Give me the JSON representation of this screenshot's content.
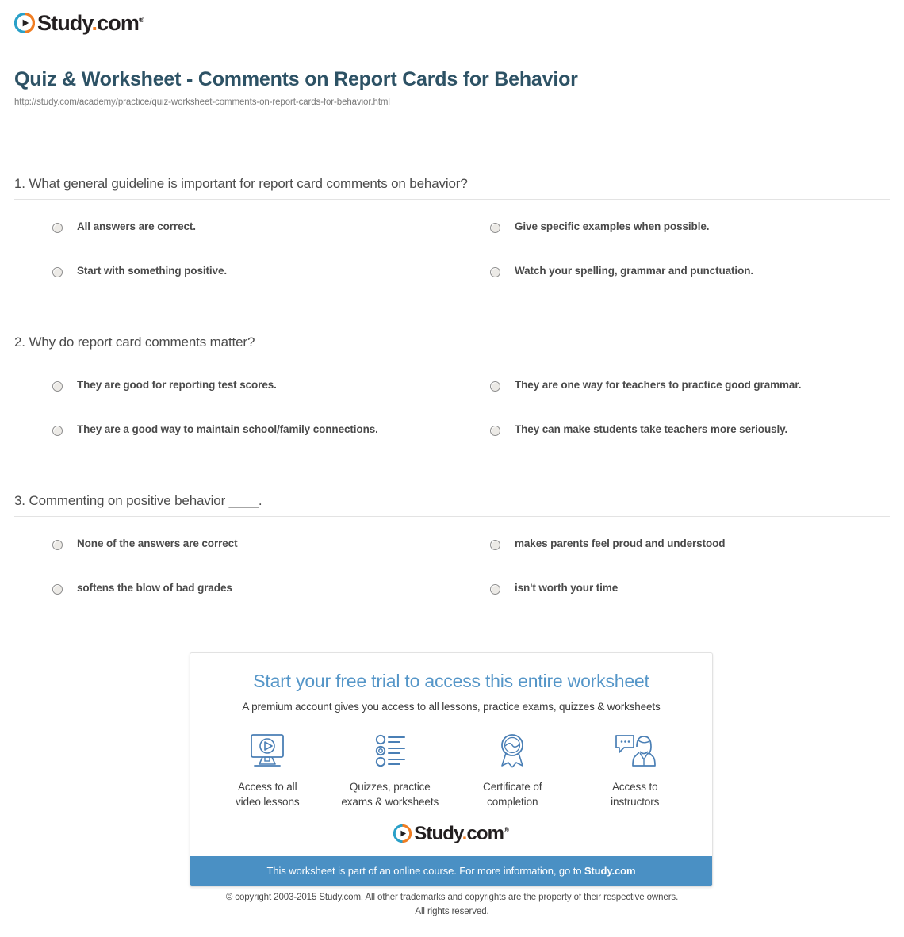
{
  "brand": {
    "logo_icon": "play-circle-icon",
    "name_part1": "Study",
    "name_dot": ".",
    "name_part2": "com",
    "trademark": "®",
    "accent_orange": "#f07d22",
    "accent_blue": "#2aa0c8",
    "word_color": "#231f20"
  },
  "header": {
    "title": "Quiz & Worksheet - Comments on Report Cards for Behavior",
    "url": "http://study.com/academy/practice/quiz-worksheet-comments-on-report-cards-for-behavior.html",
    "title_color": "#2d5265"
  },
  "questions": [
    {
      "number": "1.",
      "text": "1. What general guideline is important for report card comments on behavior?",
      "answers": [
        "All answers are correct.",
        "Give specific examples when possible.",
        "Start with something positive.",
        "Watch your spelling, grammar and punctuation."
      ]
    },
    {
      "number": "2.",
      "text": "2. Why do report card comments matter?",
      "answers": [
        "They are good for reporting test scores.",
        "They are one way for teachers to practice good grammar.",
        "They are a good way to maintain school/family connections.",
        "They can make students take teachers more seriously."
      ]
    },
    {
      "number": "3.",
      "text": "3. Commenting on positive behavior ____.",
      "answers": [
        "None of the answers are correct",
        "makes parents feel proud and understood",
        "softens the blow of bad grades",
        "isn't worth your time"
      ]
    }
  ],
  "promo": {
    "title": "Start your free trial to access this entire worksheet",
    "subtitle": "A premium account gives you access to all lessons, practice exams, quizzes & worksheets",
    "title_color": "#5596c8",
    "features": [
      {
        "icon": "monitor-play-icon",
        "label_line1": "Access to all",
        "label_line2": "video lessons"
      },
      {
        "icon": "checklist-icon",
        "label_line1": "Quizzes, practice",
        "label_line2": "exams & worksheets"
      },
      {
        "icon": "award-ribbon-icon",
        "label_line1": "Certificate of",
        "label_line2": "completion"
      },
      {
        "icon": "instructor-chat-icon",
        "label_line1": "Access to",
        "label_line2": "instructors"
      }
    ],
    "bar_text_prefix": "This worksheet is part of an online course. For more information, go to ",
    "bar_link_text": "Study.com",
    "bar_color": "#4a90c4"
  },
  "footer": {
    "line1": "© copyright 2003-2015 Study.com. All other trademarks and copyrights are the property of their respective owners.",
    "line2": "All rights reserved."
  }
}
